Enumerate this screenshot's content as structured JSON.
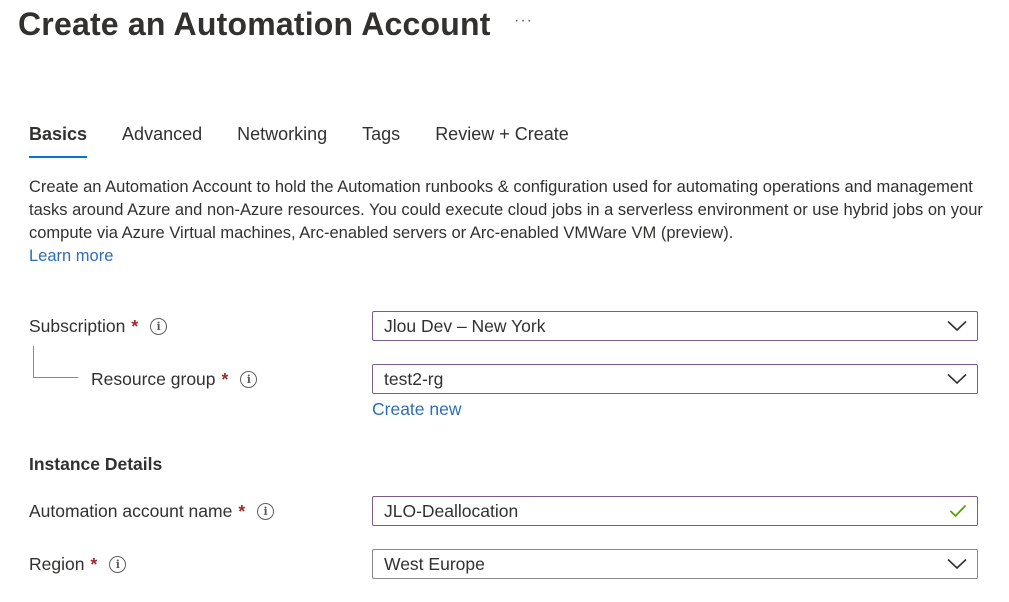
{
  "header": {
    "title": "Create an Automation Account",
    "more_label": "···"
  },
  "tabs": [
    {
      "label": "Basics",
      "active": true
    },
    {
      "label": "Advanced",
      "active": false
    },
    {
      "label": "Networking",
      "active": false
    },
    {
      "label": "Tags",
      "active": false
    },
    {
      "label": "Review + Create",
      "active": false
    }
  ],
  "description": {
    "text": "Create an Automation Account to hold the Automation runbooks & configuration used for automating operations and management tasks around Azure and non-Azure resources. You could execute cloud jobs in a serverless environment or use hybrid jobs on your compute via Azure Virtual machines, Arc-enabled servers or Arc-enabled VMWare VM (preview).",
    "learn_more": "Learn more"
  },
  "form": {
    "subscription": {
      "label": "Subscription",
      "required": "*",
      "value": "Jlou Dev – New York"
    },
    "resource_group": {
      "label": "Resource group",
      "required": "*",
      "value": "test2-rg",
      "create_new": "Create new"
    },
    "instance_details_title": "Instance Details",
    "account_name": {
      "label": "Automation account name",
      "required": "*",
      "value": "JLO-Deallocation"
    },
    "region": {
      "label": "Region",
      "required": "*",
      "value": "West Europe"
    }
  },
  "colors": {
    "accent": "#0078d4",
    "link": "#2f6db5",
    "required": "#a4262c",
    "valid": "#57a300",
    "focus_border": "#7a5c8f"
  },
  "icons": {
    "info": "info-icon",
    "dropdown": "chevron-down-icon",
    "valid": "checkmark-icon",
    "more": "more-icon"
  }
}
